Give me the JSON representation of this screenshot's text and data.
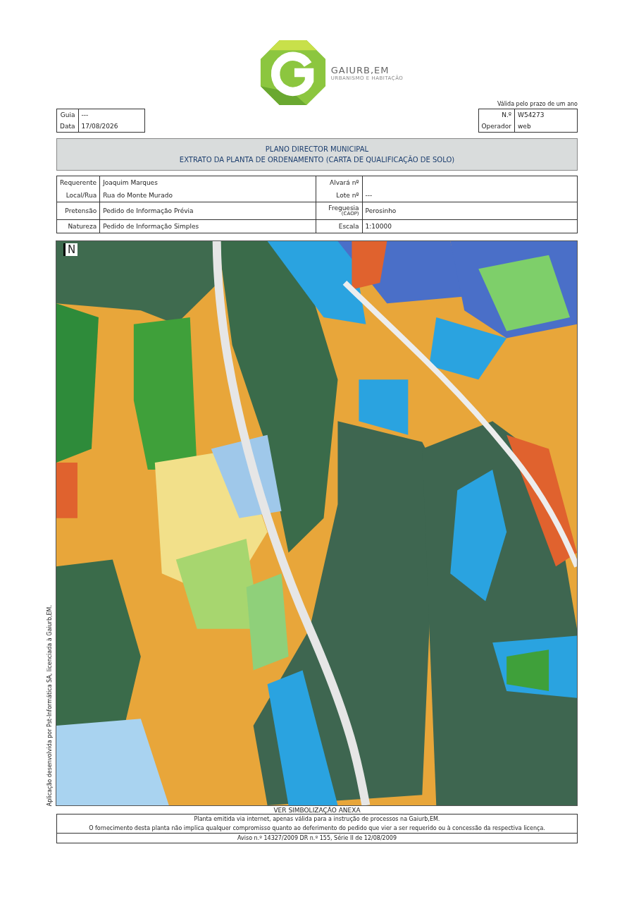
{
  "logo": {
    "name": "GAIURB,EM",
    "tagline": "URBANISMO E HABITAÇÃO"
  },
  "guia": [
    {
      "label": "Guia",
      "value": "---"
    },
    {
      "label": "Data",
      "value": "17/08/2026"
    }
  ],
  "validity": {
    "note": "Válida pelo prazo de um ano",
    "rows": [
      {
        "label": "N.º",
        "value": "W54273"
      },
      {
        "label": "Operador",
        "value": "web"
      }
    ]
  },
  "title": [
    "PLANO DIRECTOR MUNICIPAL",
    "EXTRATO DA PLANTA DE ORDENAMENTO (CARTA DE QUALIFICAÇÃO DE SOLO)"
  ],
  "details": [
    {
      "left": [
        {
          "label": "Requerente",
          "value": "Joaquim Marques"
        },
        {
          "label": "Local/Rua",
          "value": "Rua do Monte Murado"
        }
      ],
      "right": [
        {
          "label": "Alvará nº"
        },
        {
          "label": "Lote nº",
          "value": "---"
        }
      ]
    },
    {
      "left": [
        {
          "label": "Pretensão",
          "value": "Pedido de Informação Prévia"
        }
      ],
      "right": [
        {
          "label": "Freguesia",
          "sublabel": "(CAOP)",
          "value": "Perosinho"
        }
      ]
    },
    {
      "left": [
        {
          "label": "Natureza",
          "value": "Pedido de Informação Simples"
        }
      ],
      "right": [
        {
          "label": "Escala",
          "value": "1:10000"
        }
      ]
    }
  ],
  "map": {
    "north": "N",
    "side_note": "Aplicação desenvolvida por Pst-Informática SA, licenciada à Gaiurb,EM."
  },
  "legend_note": "VER SIMBOLIZAÇÃO ANEXA",
  "footer": [
    "Planta emitida via internet, apenas válida para a instrução de processos na Gaiurb,EM.",
    "O fornecimento desta planta não implica qualquer compromisso quanto ao deferimento do pedido que vier a ser requerido ou à concessão da respectiva licença.",
    "Aviso n.º 14327/2009 DR n.º 155, Série II de 12/08/2009"
  ]
}
